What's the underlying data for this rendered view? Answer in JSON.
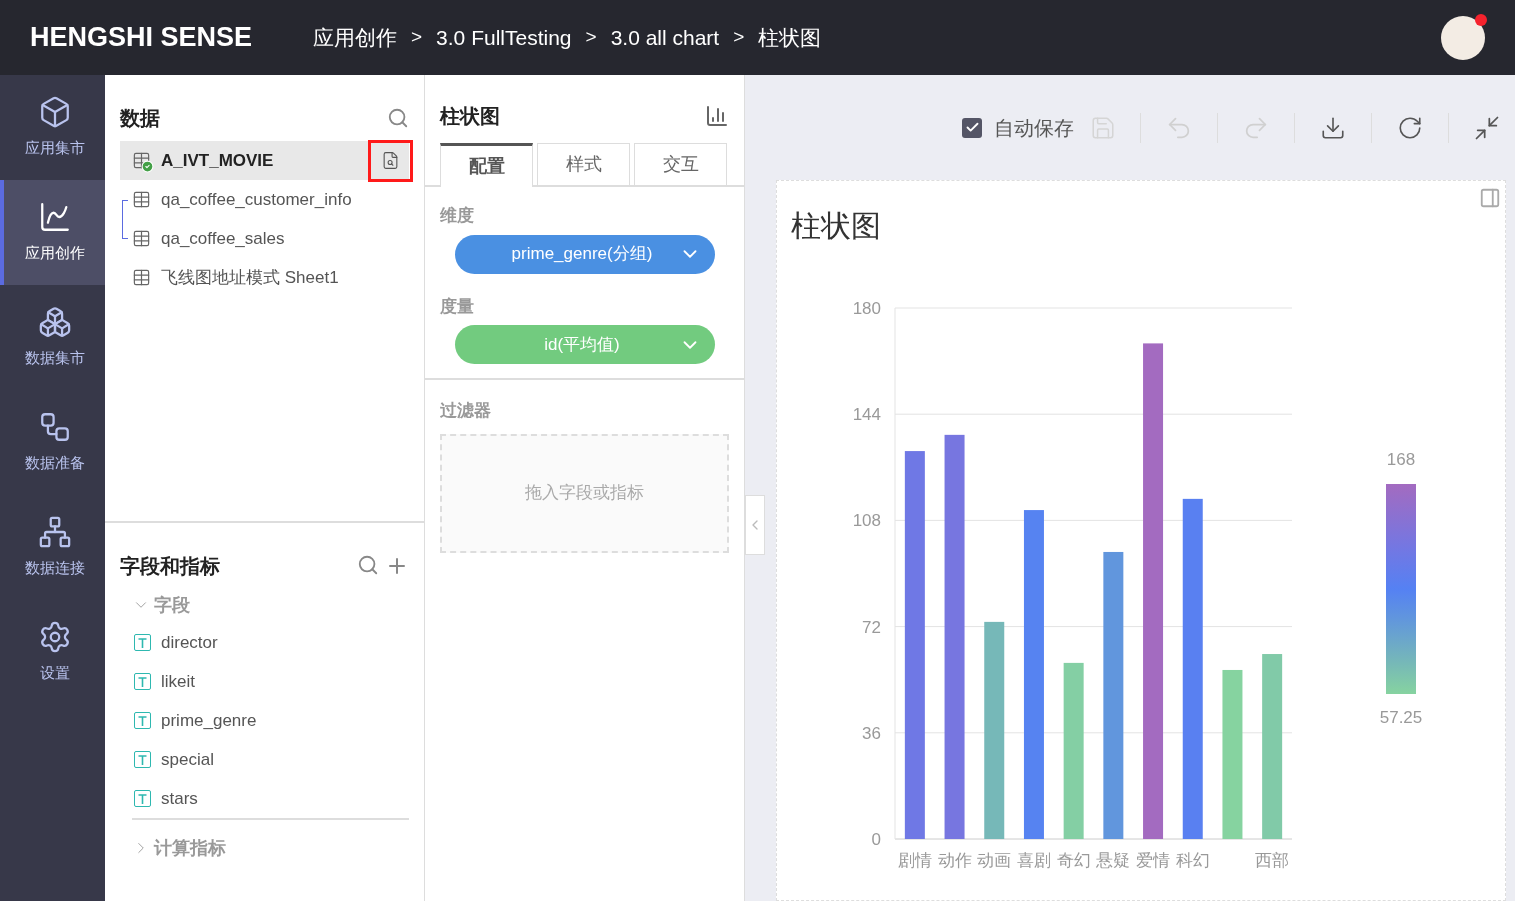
{
  "header": {
    "logo": "HENGSHI SENSE",
    "breadcrumbs": [
      "应用创作",
      "3.0 FullTesting",
      "3.0 all chart",
      "柱状图"
    ],
    "separator": ">"
  },
  "nav": [
    {
      "label": "应用集市",
      "selected": false
    },
    {
      "label": "应用创作",
      "selected": true
    },
    {
      "label": "数据集市",
      "selected": false
    },
    {
      "label": "数据准备",
      "selected": false
    },
    {
      "label": "数据连接",
      "selected": false
    },
    {
      "label": "设置",
      "selected": false
    }
  ],
  "data_panel": {
    "title": "数据",
    "datasets": [
      {
        "name": "A_IVT_MOVIE",
        "selected": true,
        "active": true,
        "linked": false
      },
      {
        "name": "qa_coffee_customer_info",
        "selected": false,
        "active": false,
        "linked": true
      },
      {
        "name": "qa_coffee_sales",
        "selected": false,
        "active": false,
        "linked": true
      },
      {
        "name": "飞线图地址模式 Sheet1",
        "selected": false,
        "active": false,
        "linked": false
      }
    ]
  },
  "fields_panel": {
    "title": "字段和指标",
    "groups": [
      {
        "label": "字段",
        "expanded": true,
        "children": [
          {
            "name": "director"
          },
          {
            "name": "likeit"
          },
          {
            "name": "prime_genre"
          },
          {
            "name": "special"
          },
          {
            "name": "stars"
          }
        ]
      },
      {
        "label": "计算指标",
        "expanded": false
      }
    ]
  },
  "config_panel": {
    "title": "柱状图",
    "tabs": [
      {
        "label": "配置",
        "selected": true
      },
      {
        "label": "样式",
        "selected": false
      },
      {
        "label": "交互",
        "selected": false
      }
    ],
    "sections": [
      {
        "label": "维度",
        "pill": {
          "text": "prime_genre(分组)",
          "color": "#4a90e2"
        }
      },
      {
        "label": "度量",
        "pill": {
          "text": "id(平均值)",
          "color": "#72cb7f"
        }
      }
    ],
    "filter": {
      "label": "过滤器",
      "placeholder": "拖入字段或指标"
    }
  },
  "toolbar": {
    "autosave": {
      "label": "自动保存",
      "checked": true
    }
  },
  "chart_card": {
    "title": "柱状图",
    "chart_data": {
      "type": "bar",
      "categories": [
        "剧情",
        "动作",
        "动画",
        "喜剧",
        "奇幻",
        "悬疑",
        "爱情",
        "科幻",
        null,
        "西部"
      ],
      "values": [
        131.5,
        137,
        73.6,
        111.5,
        59.7,
        97.3,
        168,
        115.3,
        57.3,
        62.7
      ],
      "grid": true,
      "ylim": [
        0,
        180
      ],
      "yticks": [
        0,
        36,
        72,
        108,
        144,
        180
      ]
    },
    "visual_map": {
      "max": "168",
      "min": "57.25"
    }
  }
}
